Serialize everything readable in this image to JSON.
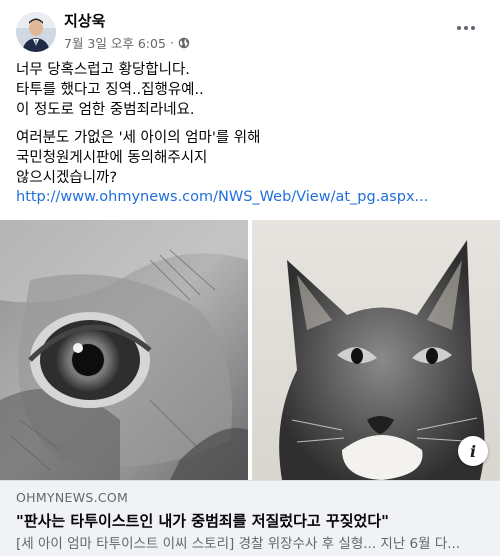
{
  "post": {
    "author": "지상욱",
    "timestamp": "7월 3일 오후 6:05",
    "separator": "·",
    "privacy_icon": "globe-icon",
    "more_icon": "more-options-icon"
  },
  "body": {
    "paragraphs": [
      [
        "너무 당혹스럽고 황당합니다.",
        "타투를 했다고 징역..집행유예..",
        "이 정도로 엄한 중범죄라네요."
      ],
      [
        "여러분도 가없은 '세 아이의 엄마'를 위해",
        "국민청원게시판에 동의해주시지",
        "않으시겠습니까?"
      ]
    ],
    "link": "http://www.ohmynews.com/NWS_Web/View/at_pg.aspx..."
  },
  "images": {
    "left_label": "owl-tattoo-image",
    "right_label": "cat-tattoo-image",
    "info_icon": "i"
  },
  "card": {
    "domain": "OHMYNEWS.COM",
    "headline": "\"판사는 타투이스트인 내가 중범죄를 저질렀다고 꾸짖었다\"",
    "description": "[세 아이 엄마 타투이스트 이씨 스토리] 경찰 위장수사 후 실형... 지난 6월 다..."
  },
  "colors": {
    "link": "#216fdb",
    "meta": "#65676b",
    "card_bg": "#f0f2f5"
  }
}
